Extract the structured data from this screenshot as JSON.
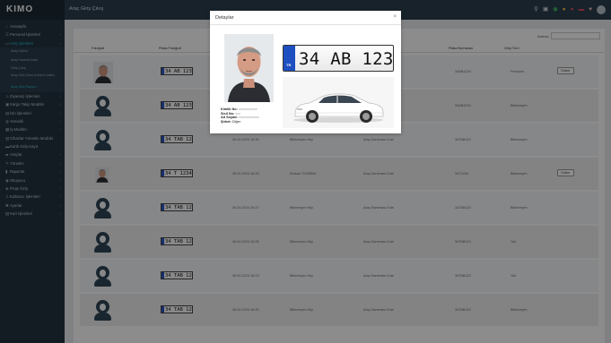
{
  "app": {
    "logo": "KIMO"
  },
  "topbar": {
    "heading": "Araç Giriş Çıkış"
  },
  "sidebar": {
    "items": [
      {
        "label": "Anasayfa",
        "icon": "home-icon",
        "chevron": false,
        "active": false
      },
      {
        "label": "Personel İşlemleri",
        "icon": "users-icon",
        "chevron": true,
        "active": false
      },
      {
        "label": "Araç İşlemleri",
        "icon": "car-icon",
        "chevron": true,
        "active": true
      },
      {
        "label": "Araç Listesi",
        "sub": true
      },
      {
        "label": "Araç Kamera Kayıt",
        "sub": true
      },
      {
        "label": "Giriş Çıkış",
        "sub": true
      },
      {
        "label": "Araç Giriş Çıkış Kontrol Listesi",
        "sub": true,
        "tall": true
      },
      {
        "label": "Araç Giriş Raporu",
        "sub": true,
        "current": true
      },
      {
        "label": "Ziyaretçi İşlemleri",
        "icon": "visitor-icon",
        "chevron": true
      },
      {
        "label": "Kargo Takip Modülü",
        "icon": "box-icon",
        "chevron": true
      },
      {
        "label": "İzin İşlemleri",
        "icon": "calendar-icon",
        "chevron": true
      },
      {
        "label": "Yemekli",
        "icon": "food-icon",
        "chevron": true
      },
      {
        "label": "İş Modülü",
        "icon": "briefcase-icon",
        "chevron": true
      },
      {
        "label": "Cihazlar Yönetim Modülü",
        "icon": "device-icon",
        "chevron": false
      },
      {
        "label": "Kartlı Giriş Kayıt",
        "icon": "card-icon",
        "chevron": false
      },
      {
        "label": "Araçlar",
        "icon": "truck-icon",
        "chevron": true
      },
      {
        "label": "Yönetim",
        "icon": "wrench-icon",
        "chevron": true
      },
      {
        "label": "Raporlar",
        "icon": "chart-icon",
        "chevron": true
      },
      {
        "label": "Okuyucu",
        "icon": "reader-icon",
        "chevron": true
      },
      {
        "label": "Proje Giriş",
        "icon": "project-icon",
        "chevron": true
      },
      {
        "label": "Kullanıcı İşlemleri",
        "icon": "user-icon",
        "chevron": true
      },
      {
        "label": "Ayarlar",
        "icon": "settings-icon",
        "chevron": true
      },
      {
        "label": "Kart İşlemleri",
        "icon": "card2-icon",
        "chevron": true
      }
    ]
  },
  "table": {
    "search_label": "Arama:",
    "columns": [
      "Fotoğraf",
      "Plaka Fotoğraf",
      "Giriş Tarihi",
      "Kullanıcı",
      "Kamera",
      "Plaka Numarası",
      "Giriş Türü"
    ],
    "rows": [
      {
        "photo": "person",
        "plate": "34 AB 1234",
        "date": "",
        "user": "",
        "camera": "",
        "plate_no": "34AB1234",
        "type": "Personel",
        "action": "Göster"
      },
      {
        "photo": "avatar",
        "plate": "34 AB 1234",
        "date": "",
        "user": "",
        "camera": "",
        "plate_no": "34AB1234",
        "type": "Bilinmeyen",
        "action": ""
      },
      {
        "photo": "avatar",
        "plate": "34 TAB 123",
        "date": "30.04.2024 16:30",
        "user": "Bilinmeyen Kişi",
        "camera": "Araç Kamerası Kule",
        "plate_no": "34TAB123",
        "type": "Bilinmeyen",
        "action": ""
      },
      {
        "photo": "person-small",
        "plate": "34 T 1234",
        "date": "30.04.2024 16:29",
        "user": "Serkan YILDIRIM",
        "camera": "Araç Kamerası Kule",
        "plate_no": "34T1234",
        "type": "Bilinmeyen",
        "action": "Göster"
      },
      {
        "photo": "avatar",
        "plate": "34 TAB 123",
        "date": "30.04.2024 16:27",
        "user": "Bilinmeyen Kişi",
        "camera": "Araç Kamerası Kule",
        "plate_no": "34TAB123",
        "type": "Bilinmeyen",
        "action": ""
      },
      {
        "photo": "avatar",
        "plate": "34 TAB 123",
        "date": "30.04.2024 16:25",
        "user": "Bilinmeyen Kişi",
        "camera": "Araç Kamerası Kule",
        "plate_no": "34TAB123",
        "type": "Yok",
        "action": ""
      },
      {
        "photo": "avatar",
        "plate": "34 TAB 123",
        "date": "30.04.2024 16:23",
        "user": "Bilinmeyen Kişi",
        "camera": "Araç Kamerası Kule",
        "plate_no": "34TAB123",
        "type": "Yok",
        "action": ""
      },
      {
        "photo": "avatar",
        "plate": "34 TAB 123",
        "date": "30.04.2024 16:20",
        "user": "Bilinmeyen Kişi",
        "camera": "Araç Kamerası Kule",
        "plate_no": "34TAB123",
        "type": "Bilinmeyen",
        "action": ""
      }
    ]
  },
  "modal": {
    "title": "Detaylar",
    "close": "×",
    "plate": "34 AB 1234",
    "plate_country": "TR",
    "info": [
      {
        "label": "Kimlik No:",
        "value": "xxxxxxxxxxx"
      },
      {
        "label": "Sicil No:",
        "value": "xxx"
      },
      {
        "label": "Ad Soyad:",
        "value": "xxxxxxxxxxxx"
      },
      {
        "label": "Şirket:",
        "value": "Diğer"
      }
    ]
  },
  "colors": {
    "sidebar": "#233341",
    "topbar": "#2b3e4f",
    "accent": "#27c3d3",
    "plate_blue": "#1d4fc1"
  }
}
